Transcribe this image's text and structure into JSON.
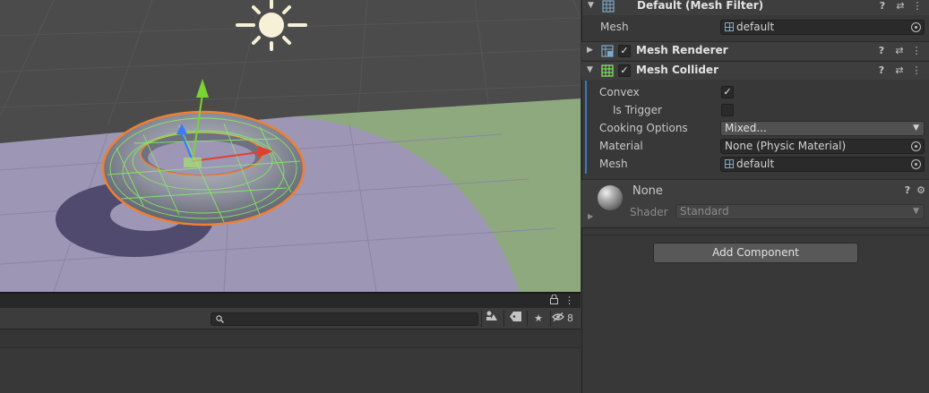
{
  "inspector": {
    "mesh_filter": {
      "title": "Default (Mesh Filter)",
      "mesh_label": "Mesh",
      "mesh_value": "default"
    },
    "mesh_renderer": {
      "title": "Mesh Renderer",
      "enabled": "✓"
    },
    "mesh_collider": {
      "title": "Mesh Collider",
      "enabled": "✓",
      "convex_label": "Convex",
      "convex_value": "✓",
      "is_trigger_label": "Is Trigger",
      "cooking_label": "Cooking Options",
      "cooking_value": "Mixed...",
      "material_label": "Material",
      "material_value": "None (Physic Material)",
      "mesh_label": "Mesh",
      "mesh_value": "default"
    },
    "material": {
      "name": "None",
      "shader_label": "Shader",
      "shader_value": "Standard"
    },
    "add_component_label": "Add Component"
  },
  "bottom_panel": {
    "search_value": "",
    "hidden_count": "8"
  },
  "icons": {
    "help": "?",
    "presets": "⇄",
    "menu": "⋮",
    "fold_open": "▼",
    "fold_closed": "▶",
    "dropdown_arrow": "▼",
    "lock": "🔒",
    "search": "⚲",
    "gear": "⚙"
  },
  "colors": {
    "accent_blue": "#3a79bb",
    "inspector_bg": "#383838",
    "header_bg": "#3e3e3e",
    "field_bg": "#2a2a2a",
    "ground_plane": "#9d97b5",
    "grass_plane": "#8fa97f",
    "selection_outline": "#f08030",
    "collider_wire": "#88ee66"
  }
}
